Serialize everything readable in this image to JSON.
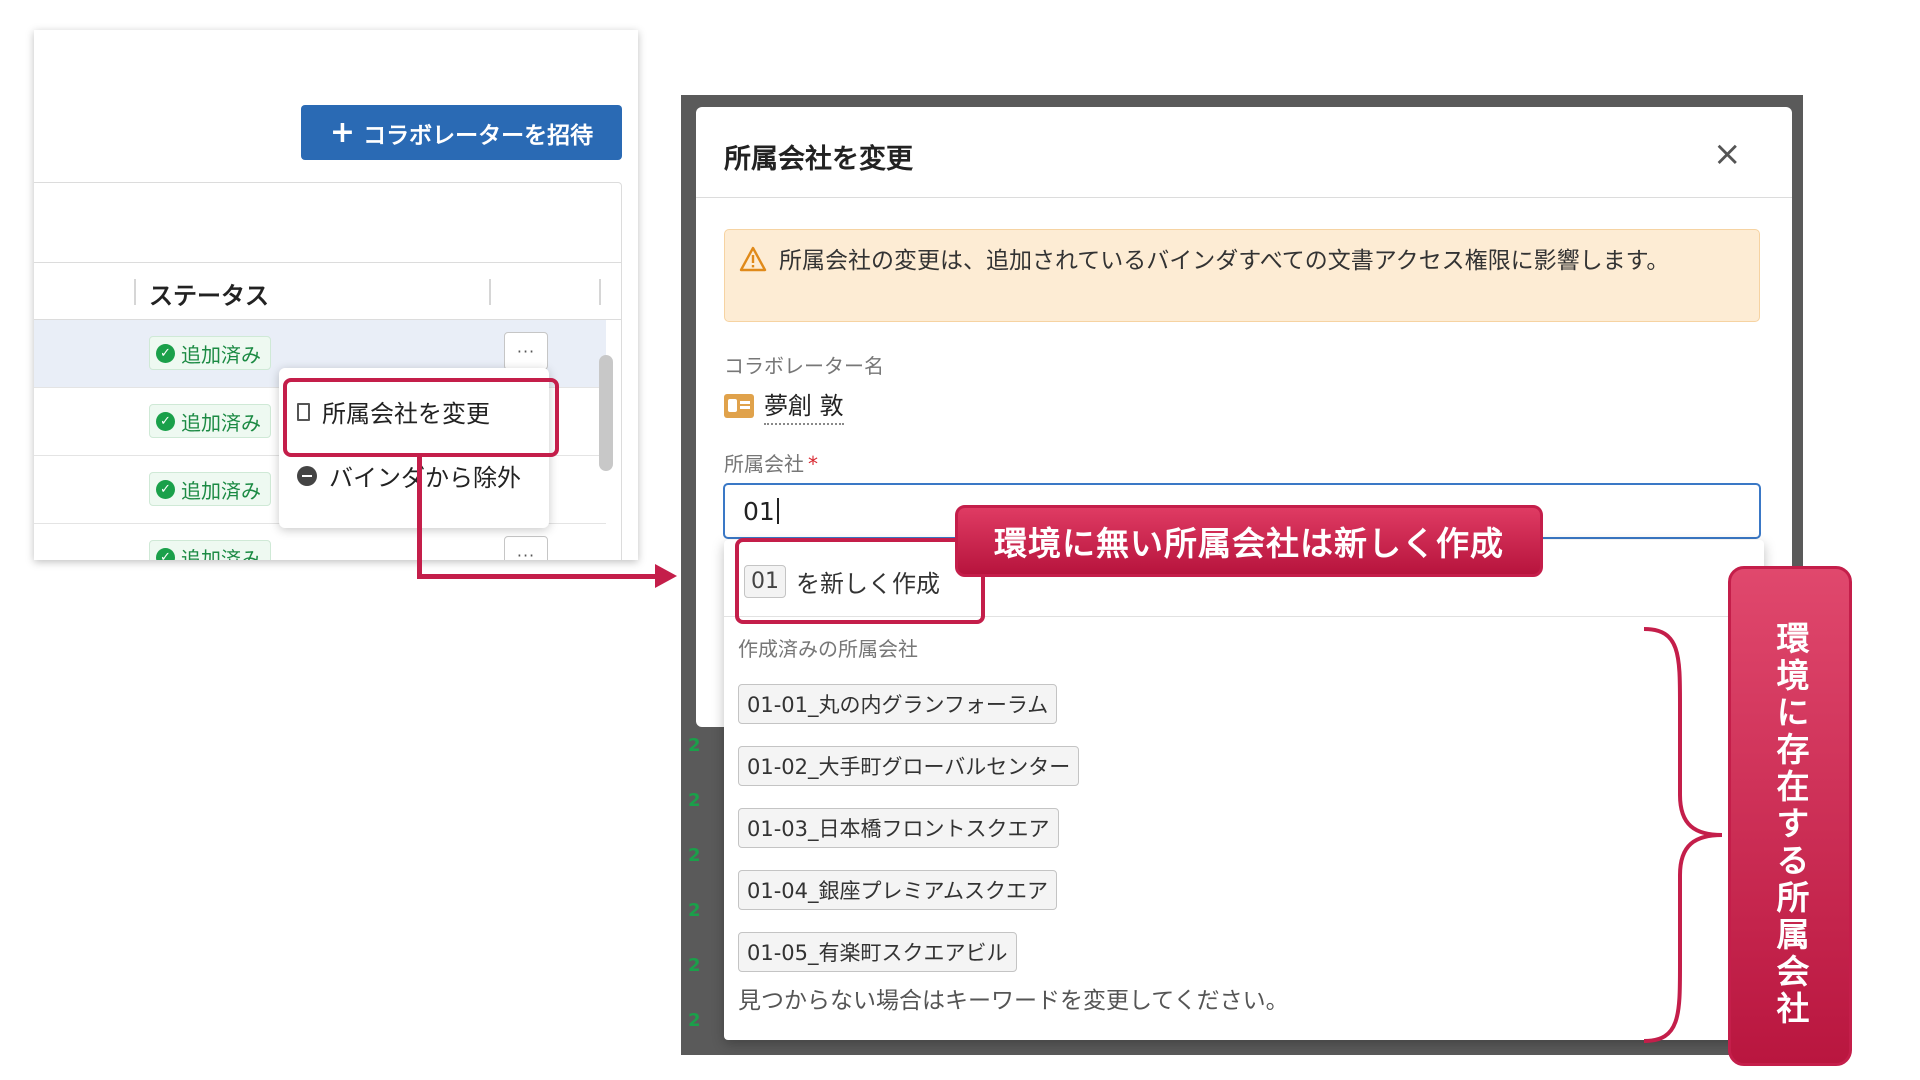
{
  "left_panel": {
    "invite_button_label": "コラボレーターを招待",
    "status_header": "ステータス",
    "rows": [
      {
        "status": "追加済み"
      },
      {
        "status": "追加済み"
      },
      {
        "status": "追加済み"
      },
      {
        "status": "追加済み"
      }
    ],
    "more_label": "···",
    "context_menu": {
      "change_company": "所属会社を変更",
      "remove_from_binder": "バインダから除外"
    }
  },
  "backdrop": {
    "row_marks": [
      "2",
      "2",
      "2",
      "2",
      "2",
      "2"
    ]
  },
  "modal": {
    "title": "所属会社を変更",
    "close": "×",
    "alert_text": "所属会社の変更は、追加されているバインダすべての文書アクセス権限に影響します。",
    "collaborator_label": "コラボレーター名",
    "collaborator_name": "夢創 敦",
    "company_label": "所属会社",
    "required_mark": "*",
    "company_input_value": "01"
  },
  "dropdown": {
    "create_tag": "01",
    "create_suffix": "を新しく作成",
    "existing_heading": "作成済みの所属会社",
    "options": [
      "01-01_丸の内グランフォーラム",
      "01-02_大手町グローバルセンター",
      "01-03_日本橋フロントスクエア",
      "01-04_銀座プレミアムスクエア",
      "01-05_有楽町スクエアビル"
    ],
    "not_found_hint": "見つからない場合はキーワードを変更してください。"
  },
  "annotations": {
    "new_company_callout": "環境に無い所属会社は新しく作成",
    "existing_company_callout": "環境に存在する所属会社"
  },
  "colors": {
    "primary": "#2a6ab4",
    "annotation": "#c41e4a",
    "success": "#1aa04a",
    "warning_bg": "#fdecd4"
  }
}
